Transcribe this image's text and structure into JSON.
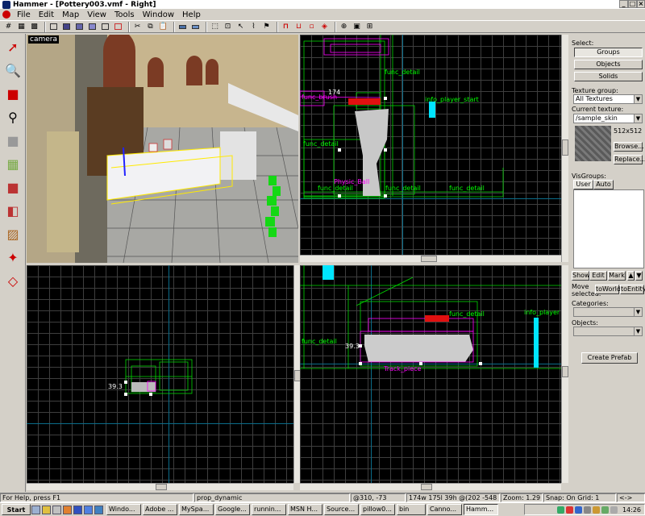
{
  "window": {
    "title": "Hammer - [Pottery003.vmf - Right]"
  },
  "menu": [
    "File",
    "Edit",
    "Map",
    "View",
    "Tools",
    "Window",
    "Help"
  ],
  "views": {
    "camera": {
      "label": "camera"
    },
    "top_right": {
      "labels": [
        "func_detail",
        "info_player_start",
        "func_detail",
        "func_detail",
        "func_detail",
        "func_detail",
        "Physic_Ball",
        "174",
        "func_brush"
      ]
    },
    "bottom_left": {
      "readout": "39.3"
    },
    "bottom_right": {
      "labels": [
        "func_detail",
        "info_player",
        "Track_piece",
        "func_detail",
        "39.3"
      ]
    }
  },
  "panel": {
    "select_label": "Select:",
    "select_buttons": [
      "Groups",
      "Objects",
      "Solids"
    ],
    "texture_group_label": "Texture group:",
    "texture_group_value": "All Textures",
    "current_texture_label": "Current texture:",
    "current_texture_value": "/sample_skin",
    "texture_size": "512x512",
    "browse": "Browse...",
    "replace": "Replace...",
    "visgroups_label": "VisGroups:",
    "vis_tabs": [
      "User",
      "Auto"
    ],
    "vis_buttons": [
      "Show",
      "Edit",
      "Mark"
    ],
    "move_selected_label": "Move selected:",
    "to_world": "toWorld",
    "to_entity": "toEntity",
    "categories_label": "Categories:",
    "objects_label": "Objects:",
    "create_prefab": "Create Prefab"
  },
  "status": {
    "help": "For Help, press F1",
    "entity": "prop_dynamic",
    "coords": "@310, -73",
    "size": "174w 175l 39h @(202 -548 30)",
    "zoom": "Zoom: 1.29",
    "snap": "Snap: On Grid: 1",
    "last": "<->"
  },
  "taskbar": {
    "start": "Start",
    "tasks": [
      "Windo...",
      "Adobe ...",
      "MySpa...",
      "Google...",
      "runnin...",
      "MSN H...",
      "Source...",
      "pillow0...",
      "bin",
      "Canno...",
      "Hamm..."
    ],
    "active_task_index": 10,
    "clock": "14:26"
  },
  "colors": {
    "grid": "#3e3e3e",
    "axis": "#0b6d8a",
    "entity_label": "#00ff00",
    "selected": "#ff00ff",
    "player": "#00e5ff"
  }
}
